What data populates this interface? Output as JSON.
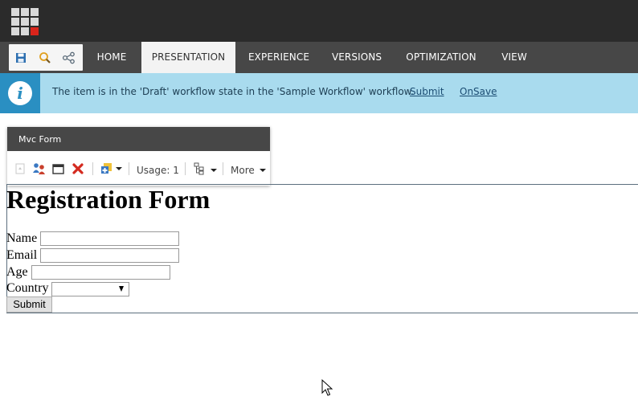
{
  "ribbon": {
    "tabs": [
      "HOME",
      "PRESENTATION",
      "EXPERIENCE",
      "VERSIONS",
      "OPTIMIZATION",
      "VIEW"
    ],
    "active_tab": "PRESENTATION",
    "quick_icons": [
      "save-icon",
      "search-icon",
      "navigator-icon"
    ]
  },
  "notice": {
    "text": "The item is in the 'Draft' workflow state in the 'Sample Workflow' workflow.",
    "submit_label": "Submit",
    "onsave_label": "OnSave",
    "icon": "info-icon"
  },
  "rendering": {
    "title": "Mvc Form",
    "usage_label": "Usage: 1",
    "more_label": "More"
  },
  "form": {
    "title": "Registration Form",
    "name_label": "Name",
    "email_label": "Email",
    "age_label": "Age",
    "country_label": "Country",
    "name_value": "",
    "email_value": "",
    "age_value": "",
    "country_value": "",
    "submit_label": "Submit"
  },
  "colors": {
    "topbar": "#2b2b2b",
    "ribbon": "#474747",
    "notice_bg": "#a9dbee",
    "notice_icon_bg": "#2a8fc2",
    "logo_accent": "#d9241b"
  }
}
